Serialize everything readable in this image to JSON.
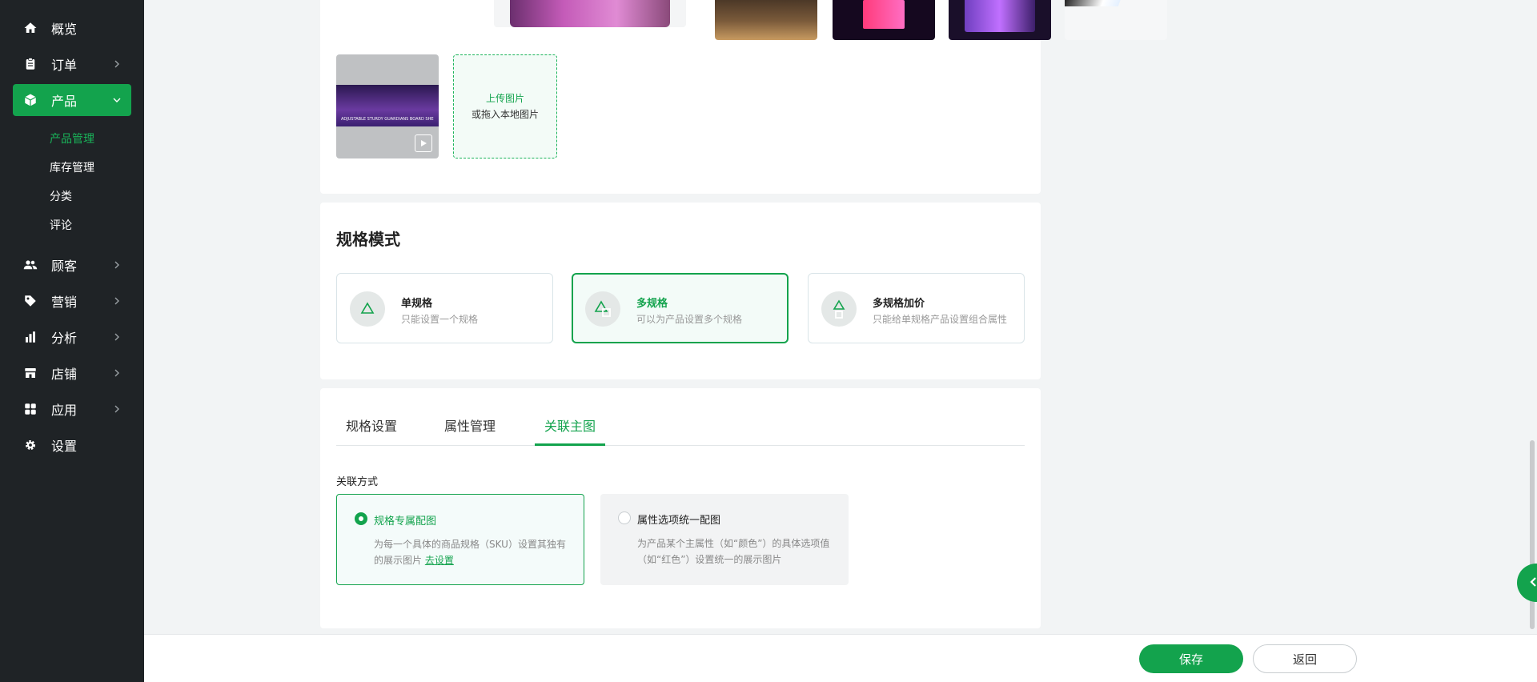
{
  "sidebar": {
    "items": [
      {
        "label": "概览",
        "icon": "home-icon"
      },
      {
        "label": "订单",
        "icon": "clipboard-icon"
      },
      {
        "label": "产品",
        "icon": "box-icon"
      },
      {
        "label": "顾客",
        "icon": "users-icon"
      },
      {
        "label": "营销",
        "icon": "tag-icon"
      },
      {
        "label": "分析",
        "icon": "bar-chart-icon"
      },
      {
        "label": "店铺",
        "icon": "store-icon"
      },
      {
        "label": "应用",
        "icon": "apps-icon"
      },
      {
        "label": "设置",
        "icon": "gear-icon"
      }
    ],
    "product_sub": [
      "产品管理",
      "库存管理",
      "分类",
      "评论"
    ]
  },
  "media": {
    "upload_primary": "上传图片",
    "upload_secondary": "或拖入本地图片",
    "video_caption": "ADJUSTABLE STURDY GUARDIANS BOARD SHELF"
  },
  "spec_mode": {
    "title": "规格模式",
    "options": [
      {
        "name": "单规格",
        "desc": "只能设置一个规格"
      },
      {
        "name": "多规格",
        "desc": "可以为产品设置多个规格"
      },
      {
        "name": "多规格加价",
        "desc": "只能给单规格产品设置组合属性"
      }
    ]
  },
  "spec_tabs": {
    "tabs": [
      "规格设置",
      "属性管理",
      "关联主图"
    ],
    "association_label": "关联方式",
    "options": [
      {
        "name": "规格专属配图",
        "desc": "为每一个具体的商品规格（SKU）设置其独有的展示图片",
        "link": "去设置"
      },
      {
        "name": "属性选项统一配图",
        "desc": "为产品某个主属性（如“颜色”）的具体选项值（如“红色”）设置统一的展示图片"
      }
    ]
  },
  "footer": {
    "save": "保存",
    "back": "返回"
  },
  "colors": {
    "accent": "#13a34d",
    "sidebar_bg": "#1f2326"
  }
}
